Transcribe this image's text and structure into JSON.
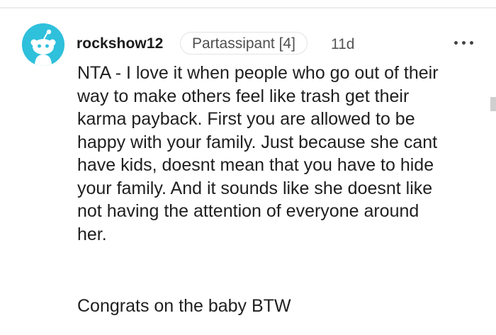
{
  "comment": {
    "username": "rockshow12",
    "flair": "Partassipant [4]",
    "age": "11d",
    "body_paragraph_1": "NTA - I love it when people who go out of their\nway to make others feel like trash get their\nkarma payback. First you are allowed to be\nhappy with your family. Just because she cant\nhave kids, doesnt mean that you have to hide\nyour family. And it sounds like she doesnt like\nnot having the attention of everyone around\nher.",
    "body_paragraph_2": "Congrats on the baby BTW"
  },
  "icons": {
    "avatar": "snoo-avatar-icon",
    "more": "more-options-icon"
  },
  "colors": {
    "avatar_background": "#2fc0dc",
    "text": "#1f1f1f",
    "secondary_text": "#555555",
    "flair_border": "#e3e3e3"
  }
}
